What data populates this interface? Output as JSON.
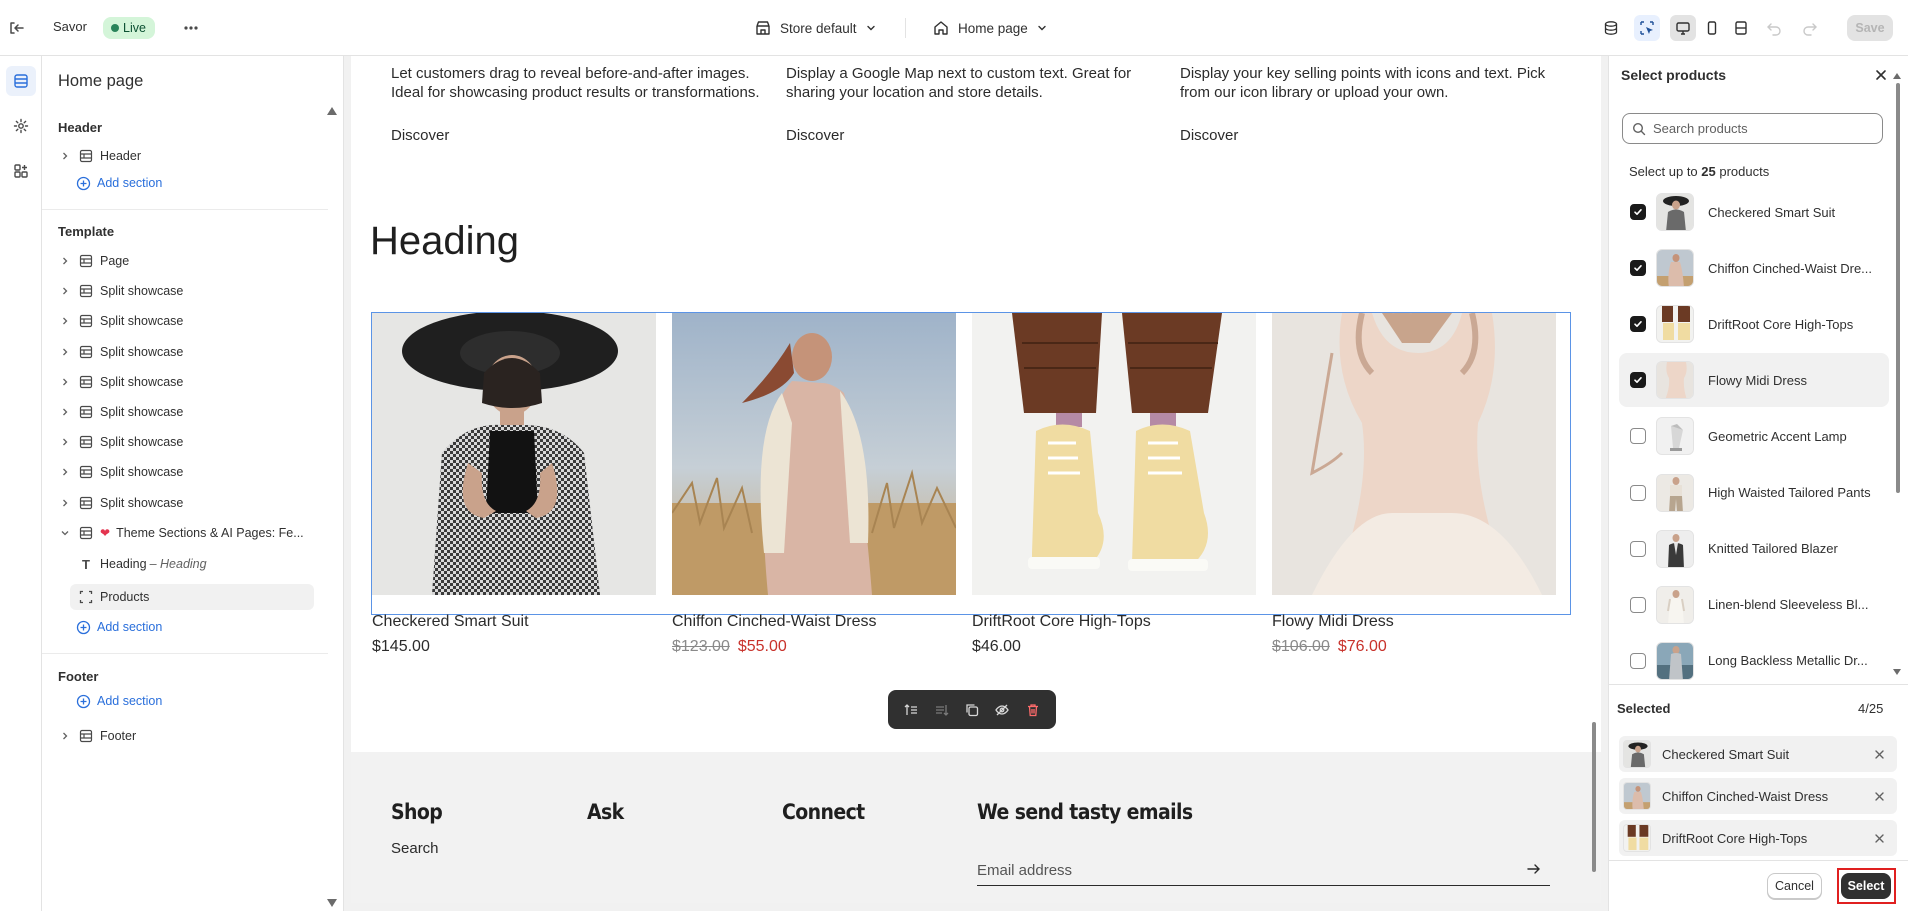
{
  "topbar": {
    "app_name": "Savor",
    "live_badge": "Live",
    "store_selector": "Store default",
    "page_selector": "Home page",
    "save_label": "Save"
  },
  "sidebar": {
    "title": "Home page",
    "header_group": "Header",
    "header_item": "Header",
    "add_section": "Add section",
    "template_group": "Template",
    "template_items": [
      "Page",
      "Split showcase",
      "Split showcase",
      "Split showcase",
      "Split showcase",
      "Split showcase",
      "Split showcase",
      "Split showcase",
      "Split showcase",
      "Theme Sections & AI Pages: Fe..."
    ],
    "heading_block": "Heading",
    "heading_block_sub": "Heading",
    "products_block": "Products",
    "footer_group": "Footer",
    "footer_item": "Footer"
  },
  "preview": {
    "features": [
      {
        "text": "Let customers drag to reveal before-and-after images. Ideal for showcasing product results or transformations.",
        "link": "Discover"
      },
      {
        "text": "Display a Google Map next to custom text. Great for sharing your location and store details.",
        "link": "Discover"
      },
      {
        "text": "Display your key selling points with icons and text. Pick from our icon library or upload your own.",
        "link": "Discover"
      }
    ],
    "heading": "Heading",
    "products": [
      {
        "title": "Checkered Smart Suit",
        "price": "$145.00",
        "compare_at": ""
      },
      {
        "title": "Chiffon Cinched-Waist Dress",
        "price": "$55.00",
        "compare_at": "$123.00"
      },
      {
        "title": "DriftRoot Core High-Tops",
        "price": "$46.00",
        "compare_at": ""
      },
      {
        "title": "Flowy Midi Dress",
        "price": "$76.00",
        "compare_at": "$106.00"
      }
    ],
    "footer": {
      "col_shop": "Shop",
      "shop_link": "Search",
      "col_ask": "Ask",
      "col_connect": "Connect",
      "col_newsletter": "We send tasty emails",
      "email_placeholder": "Email address"
    }
  },
  "panel": {
    "title": "Select products",
    "search_placeholder": "Search products",
    "limit_prefix": "Select up to ",
    "limit_number": "25",
    "limit_suffix": " products",
    "products": [
      {
        "name": "Checkered Smart Suit",
        "checked": true
      },
      {
        "name": "Chiffon Cinched-Waist Dre...",
        "checked": true
      },
      {
        "name": "DriftRoot Core High-Tops",
        "checked": true
      },
      {
        "name": "Flowy Midi Dress",
        "checked": true
      },
      {
        "name": "Geometric Accent Lamp",
        "checked": false
      },
      {
        "name": "High Waisted Tailored Pants",
        "checked": false
      },
      {
        "name": "Knitted Tailored Blazer",
        "checked": false
      },
      {
        "name": "Linen-blend Sleeveless Bl...",
        "checked": false
      },
      {
        "name": "Long Backless Metallic Dr...",
        "checked": false
      }
    ],
    "selected_title": "Selected",
    "selected_count": "4/25",
    "selected": [
      "Checkered Smart Suit",
      "Chiffon Cinched-Waist Dress",
      "DriftRoot Core High-Tops"
    ],
    "cancel_label": "Cancel",
    "select_label": "Select"
  },
  "colors": {
    "accent_blue": "#2a6fdb",
    "live_green": "#d4f5d9",
    "sale_red": "#c8322b",
    "highlight_red": "#e02020"
  }
}
